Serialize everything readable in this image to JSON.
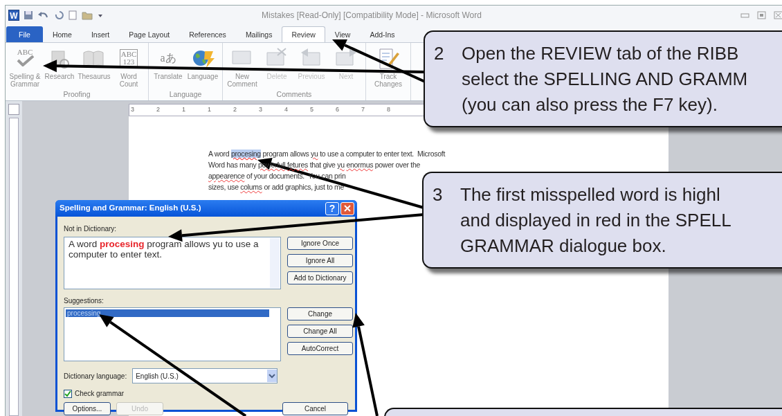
{
  "window": {
    "app_icon_letter": "W",
    "title": "Mistakes [Read-Only] [Compatibility Mode] - Microsoft Word"
  },
  "tabs": [
    {
      "label": "File",
      "kind": "file",
      "selected": false
    },
    {
      "label": "Home",
      "kind": "tab",
      "selected": false
    },
    {
      "label": "Insert",
      "kind": "tab",
      "selected": false
    },
    {
      "label": "Page Layout",
      "kind": "tab",
      "selected": false
    },
    {
      "label": "References",
      "kind": "tab",
      "selected": false
    },
    {
      "label": "Mailings",
      "kind": "tab",
      "selected": false
    },
    {
      "label": "Review",
      "kind": "tab",
      "selected": true
    },
    {
      "label": "View",
      "kind": "tab",
      "selected": false
    },
    {
      "label": "Add-Ins",
      "kind": "tab",
      "selected": false
    }
  ],
  "ribbon": {
    "groups": [
      {
        "label": "Proofing",
        "buttons": [
          {
            "label": "Spelling &\nGrammar",
            "icon_text": "ABC",
            "disabled": false
          },
          {
            "label": "Research",
            "disabled": false
          },
          {
            "label": "Thesaurus",
            "disabled": false
          },
          {
            "label": "Word\nCount",
            "icon_text": "ABC\n123",
            "disabled": false
          }
        ]
      },
      {
        "label": "Language",
        "buttons": [
          {
            "label": "Translate",
            "icon_text": "aあ",
            "disabled": false
          },
          {
            "label": "Language",
            "disabled": false
          }
        ]
      },
      {
        "label": "Comments",
        "buttons": [
          {
            "label": "New\nComment",
            "disabled": false
          },
          {
            "label": "Delete",
            "disabled": true
          },
          {
            "label": "Previous",
            "disabled": true
          },
          {
            "label": "Next",
            "disabled": true
          }
        ]
      },
      {
        "buttons": [
          {
            "label": "Track\nChanges",
            "disabled": false
          }
        ]
      }
    ]
  },
  "ruler_labels": [
    "3",
    "2",
    "1",
    "1",
    "2",
    "3",
    "4",
    "5",
    "6",
    "7",
    "8"
  ],
  "document": {
    "lines": [
      [
        {
          "text": "A word",
          "kind": "plain"
        },
        {
          "text": "procesing",
          "kind": "selected"
        },
        {
          "text": "program allows",
          "kind": "plain"
        },
        {
          "text": "yu",
          "kind": "misspelled"
        },
        {
          "text": "to use a computer to enter text.  Microsoft",
          "kind": "plain"
        }
      ],
      [
        {
          "text": "Word has many",
          "kind": "plain"
        },
        {
          "text": "powerfull",
          "kind": "misspelled"
        },
        {
          "text": "fetures",
          "kind": "misspelled"
        },
        {
          "text": "that give",
          "kind": "plain"
        },
        {
          "text": "yu",
          "kind": "misspelled"
        },
        {
          "text": "enormus",
          "kind": "misspelled"
        },
        {
          "text": "power over the",
          "kind": "plain"
        }
      ],
      [
        {
          "text": "appearence",
          "kind": "misspelled"
        },
        {
          "text": "of your documents.  You can prin",
          "kind": "plain"
        }
      ],
      [
        {
          "text": "sizes, use",
          "kind": "plain"
        },
        {
          "text": "colums",
          "kind": "misspelled"
        },
        {
          "text": "or add graphics, just to me",
          "kind": "plain"
        }
      ]
    ]
  },
  "dialog": {
    "title": "Spelling and Grammar: English (U.S.)",
    "help_glyph": "?",
    "not_in_dictionary_label": "Not in Dictionary:",
    "sentence": "A word **procesing** program allows yu to use a computer to enter text.",
    "top_buttons": [
      "Ignore Once",
      "Ignore All",
      "Add to Dictionary"
    ],
    "suggestions_label": "Suggestions:",
    "suggestions": [
      {
        "text": "processing",
        "selected": true
      }
    ],
    "change_buttons": [
      "Change",
      "Change All",
      "AutoCorrect"
    ],
    "dictionary_language_label": "Dictionary language:",
    "dictionary_language": "English (U.S.)",
    "check_grammar": {
      "label": "Check grammar",
      "checked": true
    },
    "bottom_buttons": [
      {
        "label": "Options...",
        "disabled": false
      },
      {
        "label": "Undo",
        "disabled": true
      }
    ],
    "cancel": "Cancel"
  },
  "callouts": [
    {
      "number": "2",
      "lines": [
        "Open the REVIEW tab of the RIBB",
        "select the SPELLING AND GRAMM",
        "(you can also press the F7 key)."
      ]
    },
    {
      "number": "3",
      "lines": [
        "The first misspelled word is highl",
        "and displayed in red in the SPELL",
        "GRAMMAR dialogue box."
      ]
    }
  ]
}
